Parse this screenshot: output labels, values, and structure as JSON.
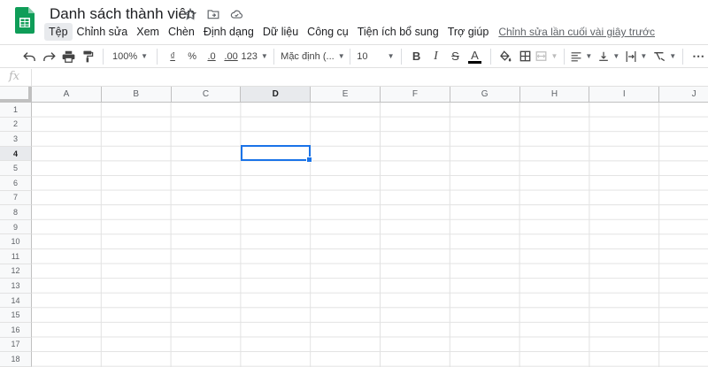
{
  "app": {
    "title": "Danh sách thành viên",
    "last_edit": "Chỉnh sửa lần cuối vài giây trước"
  },
  "menu": [
    "Tệp",
    "Chỉnh sửa",
    "Xem",
    "Chèn",
    "Định dạng",
    "Dữ liệu",
    "Công cụ",
    "Tiện ích bổ sung",
    "Trợ giúp"
  ],
  "toolbar": {
    "zoom": "100%",
    "currency": "₫",
    "percent": "%",
    "dec_decrease": ".0",
    "dec_increase": ".00",
    "number_format": "123",
    "font": "Mặc định (...",
    "font_size": "10",
    "bold": "B",
    "italic": "I",
    "strike": "S",
    "text_color": "A",
    "more": "⋯"
  },
  "formula_bar": {
    "fx": "fx",
    "value": ""
  },
  "columns": [
    "A",
    "B",
    "C",
    "D",
    "E",
    "F",
    "G",
    "H",
    "I",
    "J"
  ],
  "rows": [
    "1",
    "2",
    "3",
    "4",
    "5",
    "6",
    "7",
    "8",
    "9",
    "10",
    "11",
    "12",
    "13",
    "14",
    "15",
    "16",
    "17",
    "18"
  ],
  "selection": {
    "cell": "D4",
    "column": "D",
    "row": "4"
  },
  "colors": {
    "accent": "#1a73e8",
    "sheets_green": "#0f9d58"
  }
}
